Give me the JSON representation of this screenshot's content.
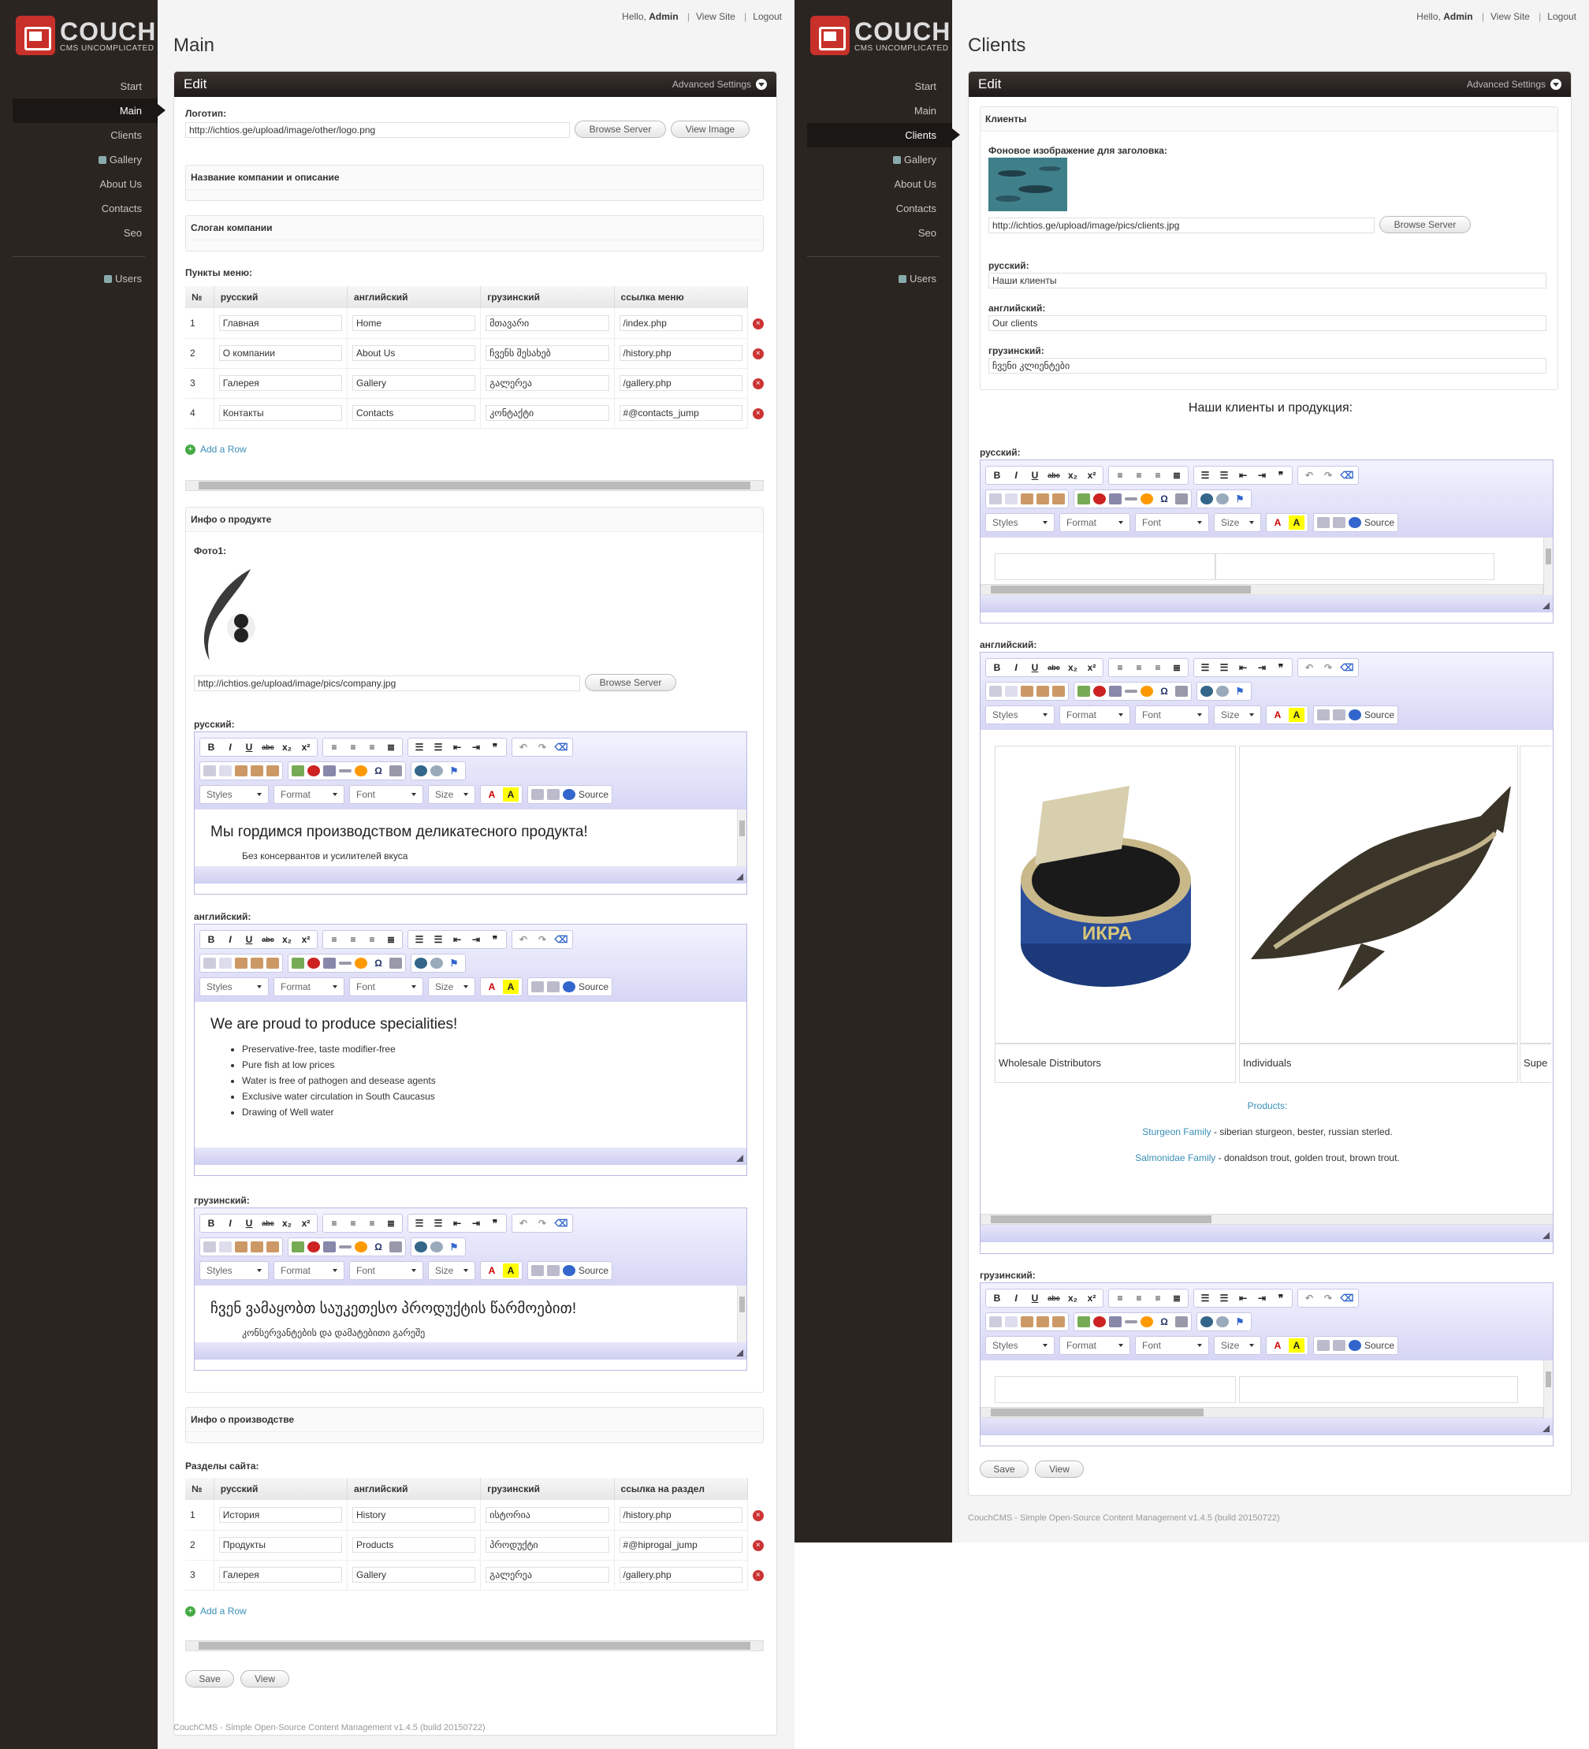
{
  "app": {
    "logo_title": "COUCH",
    "logo_sub": "CMS UNCOMPLICATED"
  },
  "topbar": {
    "hello": "Hello,",
    "user": "Admin",
    "view_site": "View Site",
    "logout": "Logout"
  },
  "nav": {
    "start": "Start",
    "main": "Main",
    "clients": "Clients",
    "gallery": "Gallery",
    "about": "About Us",
    "contacts": "Contacts",
    "seo": "Seo",
    "users": "Users"
  },
  "panel": {
    "edit": "Edit",
    "advanced": "Advanced Settings"
  },
  "buttons": {
    "browse": "Browse Server",
    "view_image": "View Image",
    "save": "Save",
    "view": "View",
    "add_row": "Add a Row"
  },
  "footer": "CouchCMS - Simple Open-Source Content Management v1.4.5 (build 20150722)",
  "editor": {
    "bold": "B",
    "italic": "I",
    "underline": "U",
    "strike": "abc",
    "sub": "x₂",
    "sup": "x²",
    "styles": "Styles",
    "format": "Format",
    "font": "Font",
    "size": "Size",
    "source": "Source"
  },
  "main": {
    "title": "Main",
    "logo_label": "Логотип:",
    "logo_value": "http://ichtios.ge/upload/image/other/logo.png",
    "company_group": "Название компании и описание",
    "slogan_group": "Слоган компании",
    "menu_label": "Пункты меню:",
    "menu_headers": [
      "№",
      "русский",
      "английский",
      "грузинский",
      "ссылка меню"
    ],
    "menu_rows": [
      [
        "1",
        "Главная",
        "Home",
        "მთავარი",
        "/index.php"
      ],
      [
        "2",
        "О компании",
        "About Us",
        "ჩვენს შესახებ",
        "/history.php"
      ],
      [
        "3",
        "Галерея",
        "Gallery",
        "გალერეა",
        "/gallery.php"
      ],
      [
        "4",
        "Контакты",
        "Contacts",
        "კონტაქტი",
        "#@contacts_jump"
      ]
    ],
    "product_group": "Инфо о продукте",
    "photo_label": "Фото1:",
    "photo_value": "http://ichtios.ge/upload/image/pics/company.jpg",
    "ru_label": "русский:",
    "ru_heading": "Мы гордимся производством деликатесного продукта!",
    "ru_bullet": "Без консервантов и усилителей вкуса",
    "en_label": "английский:",
    "en_heading": "We are proud to produce specialities!",
    "en_bullets": [
      "Preservative-free, taste modifier-free",
      "Pure fish at low prices",
      "Water is free of pathogen and desease agents",
      "Exclusive water circulation in South Caucasus",
      "Drawing of Well water"
    ],
    "ka_label": "грузинский:",
    "ka_heading": "ჩვენ ვამაყობთ საუკეთესო პროდუქტის წარმოებით!",
    "ka_bullet": "კონსერვანტების და დამატებითი გარეშე",
    "production_group": "Инфо о производстве",
    "sections_label": "Разделы сайта:",
    "sections_headers": [
      "№",
      "русский",
      "английский",
      "грузинский",
      "ссылка на раздел"
    ],
    "sections_rows": [
      [
        "1",
        "История",
        "History",
        "ისტორია",
        "/history.php"
      ],
      [
        "2",
        "Продукты",
        "Products",
        "პროდუქტი",
        "#@hiprogal_jump"
      ],
      [
        "3",
        "Галерея",
        "Gallery",
        "გალერეა",
        "/gallery.php"
      ]
    ]
  },
  "clients": {
    "title": "Clients",
    "group": "Клиенты",
    "bg_label": "Фоновое изображение для заголовка:",
    "bg_value": "http://ichtios.ge/upload/image/pics/clients.jpg",
    "ru_label": "русский:",
    "ru_value": "Наши клиенты",
    "en_label": "английский:",
    "en_value": "Our clients",
    "ka_label": "грузинский:",
    "ka_value": "ჩვენი კლიენტები",
    "section_title": "Наши клиенты и продукция:",
    "cell1": "Wholesale Distributors",
    "cell2": "Individuals",
    "cell3": "Supe",
    "products": "Products:",
    "sturgeon_link": "Sturgeon Family",
    "sturgeon_text": " - siberian sturgeon, bester, russian sterled.",
    "salmon_link": "Salmonidae Family",
    "salmon_text": " - donaldson trout, golden trout, brown trout."
  }
}
